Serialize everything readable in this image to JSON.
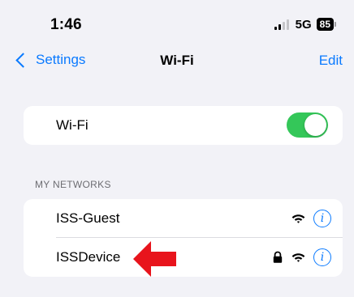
{
  "status_bar": {
    "time": "1:46",
    "network_type": "5G",
    "battery_level": "85",
    "signal_bars_active": 2,
    "signal_bars_total": 4
  },
  "nav": {
    "back_label": "Settings",
    "title": "Wi-Fi",
    "edit_label": "Edit"
  },
  "wifi_toggle": {
    "label": "Wi-Fi",
    "enabled": true
  },
  "my_networks": {
    "header": "MY NETWORKS",
    "items": [
      {
        "name": "ISS-Guest",
        "secured": false
      },
      {
        "name": "ISSDevice",
        "secured": true
      }
    ]
  },
  "colors": {
    "accent": "#0a7aff",
    "toggle_on": "#34c759",
    "annotation_arrow": "#e8141c",
    "background": "#f2f2f7"
  },
  "icons": {
    "back": "chevron-left-icon",
    "lock": "lock-icon",
    "wifi": "wifi-icon",
    "info": "info-icon",
    "annotation": "red-arrow-icon"
  }
}
